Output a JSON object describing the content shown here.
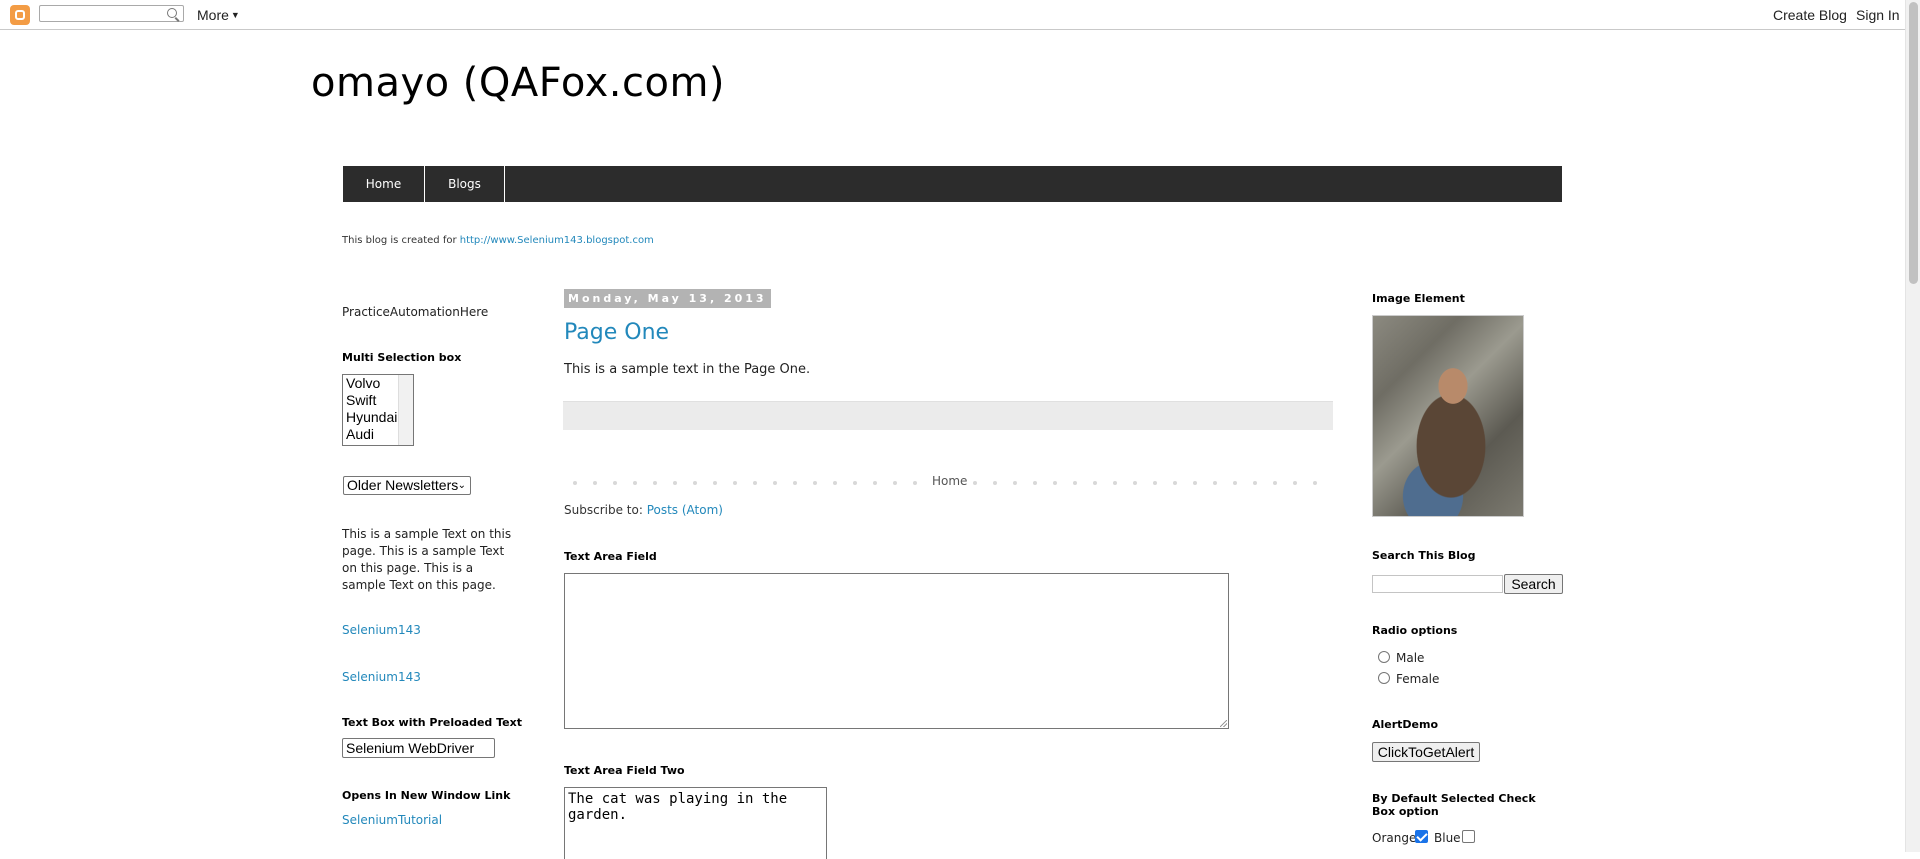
{
  "navbar": {
    "more_label": "More",
    "create_blog": "Create Blog",
    "sign_in": "Sign In"
  },
  "header": {
    "title": "omayo (QAFox.com)",
    "tabs": [
      {
        "label": "Home"
      },
      {
        "label": "Blogs"
      }
    ],
    "description_text": "This blog is created for ",
    "description_link": "http://www.Selenium143.blogspot.com"
  },
  "left_sidebar": {
    "practice_text": "PracticeAutomationHere",
    "multi_heading": "Multi Selection box",
    "multi_options": [
      "Volvo",
      "Swift",
      "Hyundai",
      "Audi"
    ],
    "newsletter_selected": "Older Newsletters",
    "sample_text": "This is a sample Text on this page. This is a sample Text on this page. This is a sample Text on this page.",
    "link1": "Selenium143",
    "link2": "Selenium143",
    "preloaded_heading": "Text Box with Preloaded Text",
    "preloaded_value": "Selenium WebDriver",
    "new_window_heading": "Opens In New Window Link",
    "new_window_link": "SeleniumTutorial"
  },
  "main": {
    "date": "Monday, May 13, 2013",
    "post_title": "Page One",
    "post_body": "This is a sample text in the Page One.",
    "home_link": "Home",
    "subscribe_prefix": "Subscribe to: ",
    "subscribe_link": "Posts (Atom)",
    "textarea1_heading": "Text Area Field",
    "textarea1_value": "",
    "textarea2_heading": "Text Area Field Two",
    "textarea2_value": "The cat was playing in the garden."
  },
  "right_sidebar": {
    "image_heading": "Image Element",
    "search_heading": "Search This Blog",
    "search_button": "Search",
    "radio_heading": "Radio options",
    "radio_male": "Male",
    "radio_female": "Female",
    "alert_heading": "AlertDemo",
    "alert_button": "ClickToGetAlert",
    "checkbox_heading": "By Default Selected Check Box option",
    "checkbox_orange": "Orange",
    "checkbox_orange_checked": true,
    "checkbox_blue": "Blue",
    "checkbox_blue_checked": false
  },
  "colors": {
    "link": "#2288bb",
    "tab_bar": "#2c2c2c",
    "date_badge": "#b3b3b3",
    "checkbox_checked": "#1a73e8"
  }
}
